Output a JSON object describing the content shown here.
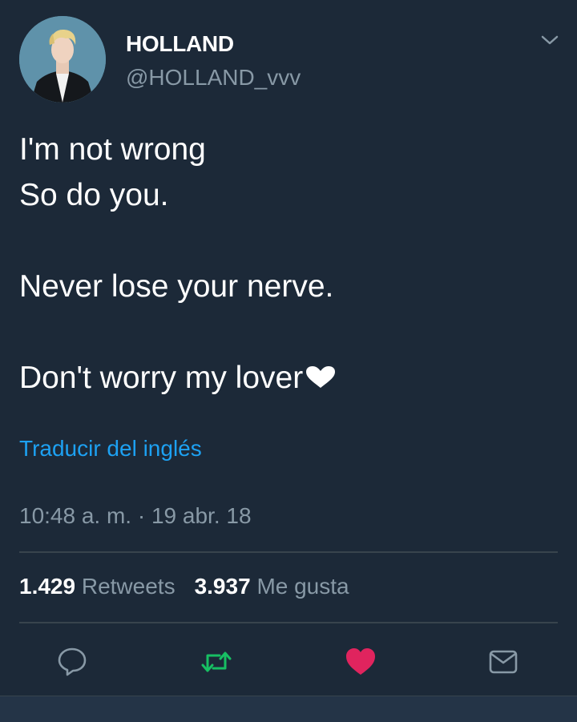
{
  "user": {
    "display_name": "HOLLAND",
    "handle": "@HOLLAND_vvv"
  },
  "tweet": {
    "lines": [
      "I'm not wrong",
      "So do you.",
      "",
      "Never lose your nerve.",
      "",
      "Don't worry my lover"
    ],
    "trailing_emoji": "heart-icon",
    "translate_link": "Traducir del inglés",
    "timestamp": "10:48 a. m. · 19 abr. 18"
  },
  "stats": {
    "retweets_count": "1.429",
    "retweets_label": "Retweets",
    "likes_count": "3.937",
    "likes_label": "Me gusta"
  },
  "actions": [
    {
      "name": "reply-icon"
    },
    {
      "name": "retweet-icon",
      "color": "#17bf63"
    },
    {
      "name": "like-icon",
      "color": "#e0245e"
    },
    {
      "name": "direct-message-icon"
    }
  ],
  "colors": {
    "background": "#1c2938",
    "link": "#1da1f2",
    "secondary_text": "#8899a6",
    "retweet_active": "#17bf63",
    "like_active": "#e0245e"
  }
}
